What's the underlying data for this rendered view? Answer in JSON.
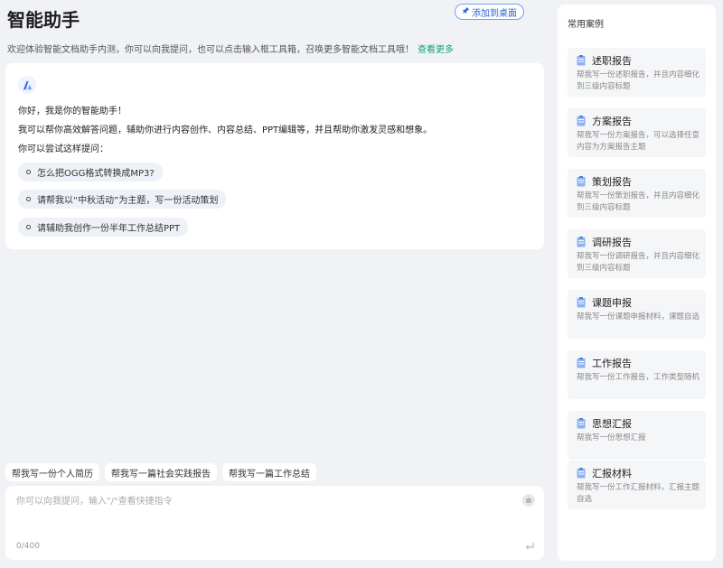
{
  "header": {
    "title": "智能助手",
    "pin_label": "添加到桌面",
    "welcome_text": "欢迎体验智能文档助手内测，你可以向我提问，也可以点击输入框工具箱，召唤更多智能文档工具哦！",
    "more_label": "查看更多"
  },
  "chat": {
    "greeting": "你好，我是你的智能助手！",
    "intro": "我可以帮你高效解答问题，辅助你进行内容创作、内容总结、PPT编辑等，并且帮助你激发灵感和想象。",
    "try_label": "你可以尝试这样提问：",
    "suggestions": [
      "怎么把OGG格式转换成MP3?",
      "请帮我以“中秋活动”为主题，写一份活动策划",
      "请辅助我创作一份半年工作总结PPT"
    ]
  },
  "quick_prompts": [
    "帮我写一份个人简历",
    "帮我写一篇社会实践报告",
    "帮我写一篇工作总结"
  ],
  "input": {
    "placeholder": "你可以向我提问，输入\"/\"查看快捷指令",
    "counter": "0/400"
  },
  "panel": {
    "title": "常用案例",
    "cases": [
      {
        "title": "述职报告",
        "desc": "帮我写一份述职报告，并且内容细化到三级内容标题"
      },
      {
        "title": "方案报告",
        "desc": "帮我写一份方案报告，可以选择任意内容为方案报告主题"
      },
      {
        "title": "策划报告",
        "desc": "帮我写一份策划报告，并且内容细化到三级内容标题"
      },
      {
        "title": "调研报告",
        "desc": "帮我写一份调研报告，并且内容细化到三级内容标题"
      },
      {
        "title": "课题申报",
        "desc": "帮我写一份课题申报材料，课题自选"
      },
      {
        "title": "工作报告",
        "desc": "帮我写一份工作报告，工作类型随机"
      },
      {
        "title": "思想汇报",
        "desc": "帮我写一份思想汇报"
      },
      {
        "title": "汇报材料",
        "desc": "帮我写一份工作汇报材料，汇报主题自选"
      }
    ]
  },
  "colors": {
    "accent": "#2b64d8",
    "link": "#16a17a",
    "background": "#f0f2f5"
  }
}
